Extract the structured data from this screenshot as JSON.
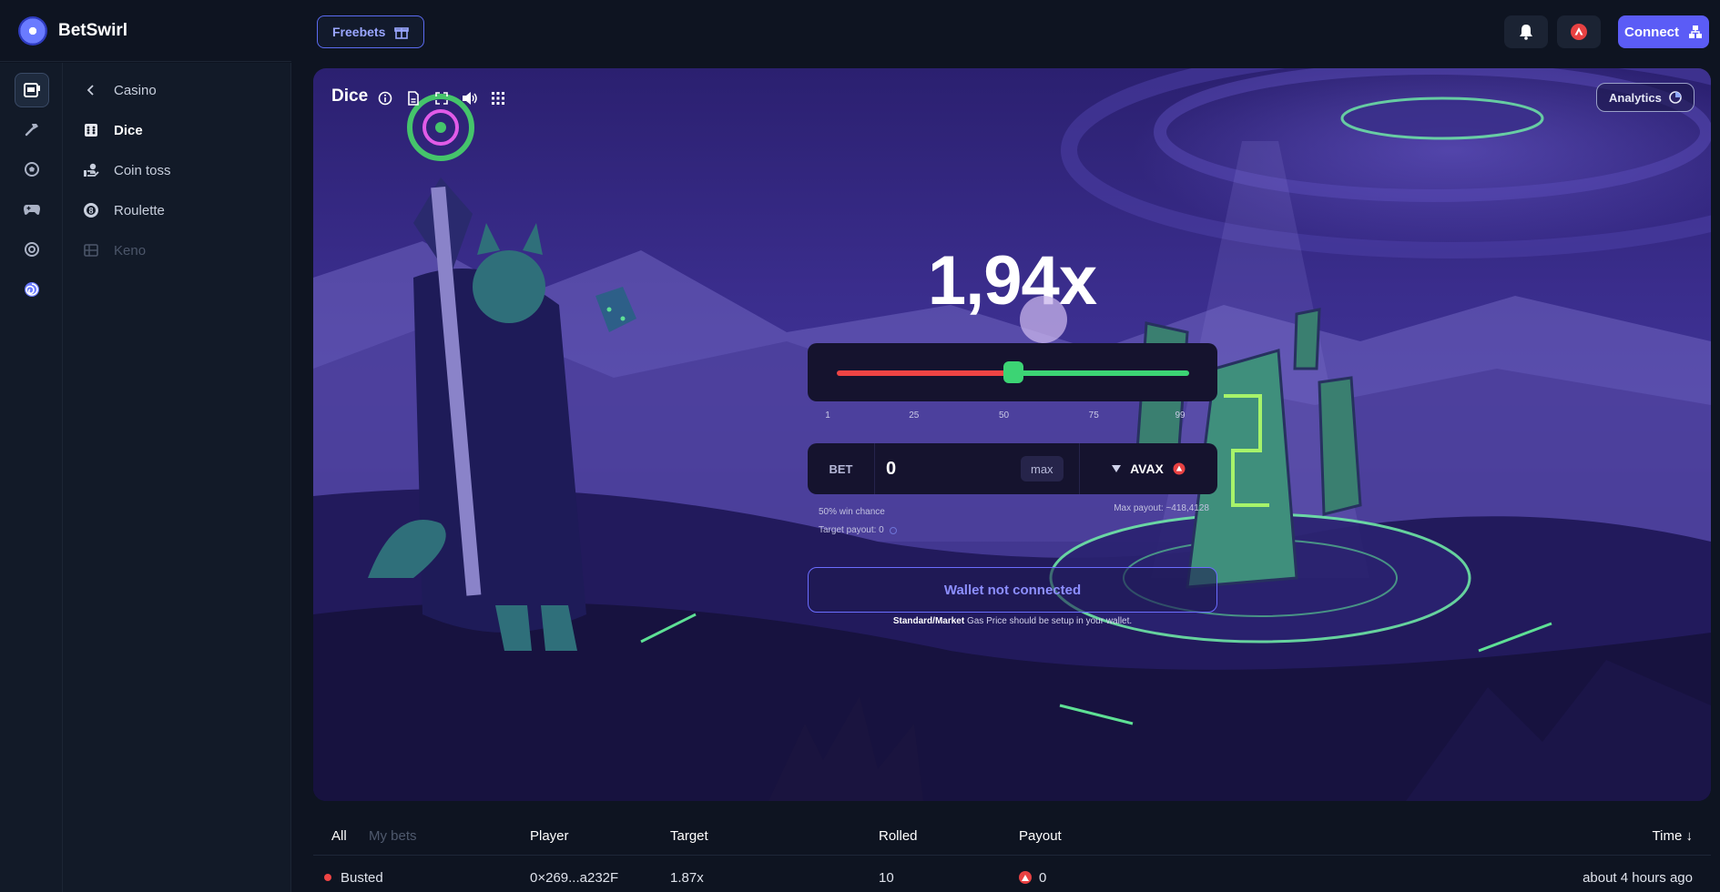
{
  "brand": {
    "name": "BetSwirl"
  },
  "rail": {
    "items": [
      {
        "name": "casino",
        "icon": "slot-machine-icon"
      },
      {
        "name": "tools",
        "icon": "hammer-icon"
      },
      {
        "name": "sports",
        "icon": "soccer-ball-icon"
      },
      {
        "name": "games",
        "icon": "gamepad-icon"
      },
      {
        "name": "tokens",
        "icon": "coins-icon"
      },
      {
        "name": "betswirl",
        "icon": "swirl-logo-icon"
      }
    ]
  },
  "menu": {
    "back_label": "Casino",
    "items": [
      {
        "label": "Dice",
        "icon": "dice-icon",
        "state": "active"
      },
      {
        "label": "Coin toss",
        "icon": "coin-hand-icon",
        "state": "normal"
      },
      {
        "label": "Roulette",
        "icon": "roulette-icon",
        "state": "normal"
      },
      {
        "label": "Keno",
        "icon": "keno-grid-icon",
        "state": "disabled"
      }
    ]
  },
  "topbar": {
    "freebets_label": "Freebets",
    "connect_label": "Connect"
  },
  "game": {
    "title": "Dice",
    "analytics_label": "Analytics",
    "multiplier": "1,94x",
    "slider": {
      "value": 50,
      "min": 1,
      "max": 99,
      "ticks": [
        "1",
        "25",
        "50",
        "75",
        "99"
      ]
    },
    "bet": {
      "label": "BET",
      "value": "0",
      "max_label": "max",
      "token": "AVAX"
    },
    "win_chance": "50% win chance",
    "target_payout": "Target payout: 0",
    "max_payout": "Max payout: ~418,4128",
    "wallet_button": "Wallet not connected",
    "gas_note_bold": "Standard/Market",
    "gas_note_rest": " Gas Price should be setup in your wallet."
  },
  "table": {
    "tabs": {
      "all": "All",
      "mine": "My bets"
    },
    "columns": {
      "player": "Player",
      "target": "Target",
      "rolled": "Rolled",
      "payout": "Payout",
      "time": "Time ↓"
    },
    "rows": [
      {
        "status": "Busted",
        "player": "0×269...a232F",
        "target": "1.87x",
        "rolled": "10",
        "payout": "0",
        "time": "about 4 hours ago"
      }
    ]
  },
  "colors": {
    "accent": "#5b5cf6",
    "lose": "#ef4444",
    "win": "#3cd474",
    "avax": "#e84142"
  }
}
